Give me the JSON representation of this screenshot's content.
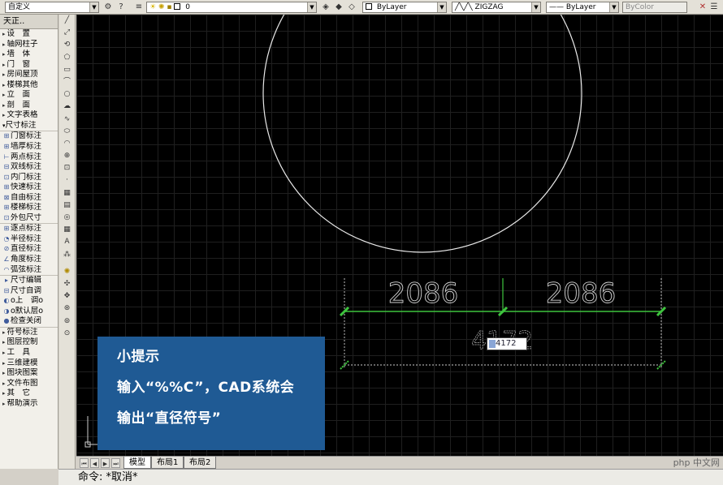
{
  "toolbar": {
    "workspace": "自定义",
    "layer": "0",
    "color": "ByLayer",
    "linetype": "ZIGZAG",
    "lineweight": "ByLayer",
    "plotstyle": "ByColor"
  },
  "menu": {
    "title": "天正..",
    "groups": [
      [
        "设　置",
        "轴网柱子",
        "墙　体",
        "门　窗",
        "房间屋顶",
        "楼梯其他",
        "立　面",
        "剖　面",
        "文字表格",
        "尺寸标注"
      ],
      [
        "门窗标注",
        "墙厚标注",
        "两点标注",
        "双线标注",
        "内门标注",
        "快速标注",
        "自由标注",
        "楼梯标注",
        "外包尺寸"
      ],
      [
        "逐点标注",
        "半径标注",
        "直径标注",
        "角度标注",
        "弧弦标注"
      ],
      [
        "尺寸编辑",
        "尺寸自调",
        "o上　调o",
        "o默认层o",
        "检查关闭"
      ],
      [
        "符号标注",
        "图层控制",
        "工　具",
        "三维建模",
        "图块图案",
        "文件布图",
        "其　它",
        "帮助演示"
      ]
    ]
  },
  "drawing": {
    "dim_left": "2086",
    "dim_right": "2086",
    "dim_total_ghost": "4172",
    "input_value": "4172"
  },
  "hint": {
    "title": "小提示",
    "line1": "输入“%%C”，CAD系统会",
    "line2": "输出“直径符号”"
  },
  "tabs": {
    "model": "模型",
    "layout1": "布局1",
    "layout2": "布局2"
  },
  "watermark": "php 中文网",
  "command": "命令: *取消*"
}
